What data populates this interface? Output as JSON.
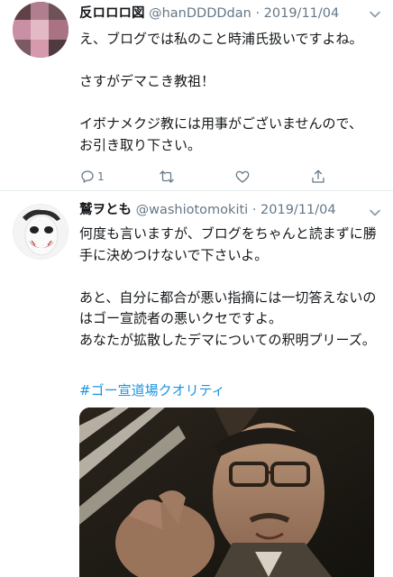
{
  "tweets": [
    {
      "display_name": "反ロロロ図",
      "handle": "@hanDDDDdan",
      "date": "· 2019/11/04",
      "text": "え、ブログでは私のこと時浦氏扱いですよね。\n\nさすがデマこき教祖！\n\nイボナメクジ教には用事がございませんので、お引き取り下さい。",
      "reply_count": "1",
      "retweet_count": "",
      "like_count": ""
    },
    {
      "display_name": "鷲ヲとも",
      "handle": "@washiotomokiti",
      "date": "· 2019/11/04",
      "text": "何度も言いますが、ブログをちゃんと読まずに勝手に決めつけないで下さいよ。\n\nあと、自分に都合が悪い指摘には一切答えないのはゴー宣読者の悪いクセですよ。\nあなたが拡散したデマについての釈明プリーズ。",
      "hashtag": "#ゴー宣道場クオリティ"
    }
  ],
  "colors": {
    "accent": "#1b95e0",
    "secondary_text": "#657786",
    "divider": "#e6ecf0"
  },
  "icons": [
    "chevron-down-icon",
    "reply-icon",
    "retweet-icon",
    "like-icon",
    "share-icon"
  ]
}
